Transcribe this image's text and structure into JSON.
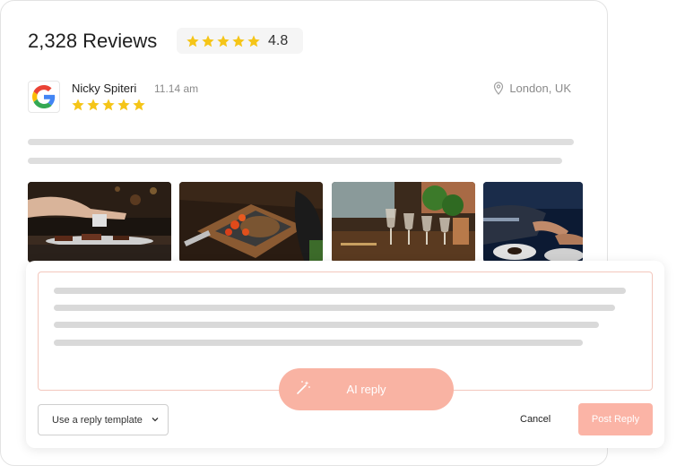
{
  "header": {
    "review_count": "2,328 Reviews",
    "rating": "4.8",
    "rating_stars": 5
  },
  "review": {
    "reviewer_name": "Nicky Spiteri",
    "time": "11.14 am",
    "location": "London, UK",
    "source_icon": "google-icon",
    "stars": 5,
    "photos": [
      "chef-plating-photo",
      "steak-tomatoes-photo",
      "glassware-table-photo",
      "plated-dishes-photo"
    ]
  },
  "reply": {
    "ai_reply_label": "AI reply",
    "template_label": "Use a reply template",
    "cancel_label": "Cancel",
    "post_label": "Post Reply"
  },
  "colors": {
    "star": "#f5c518",
    "accent": "#f9b3a3",
    "reply_border": "#f3c7bd",
    "placeholder_line": "#dedede"
  }
}
